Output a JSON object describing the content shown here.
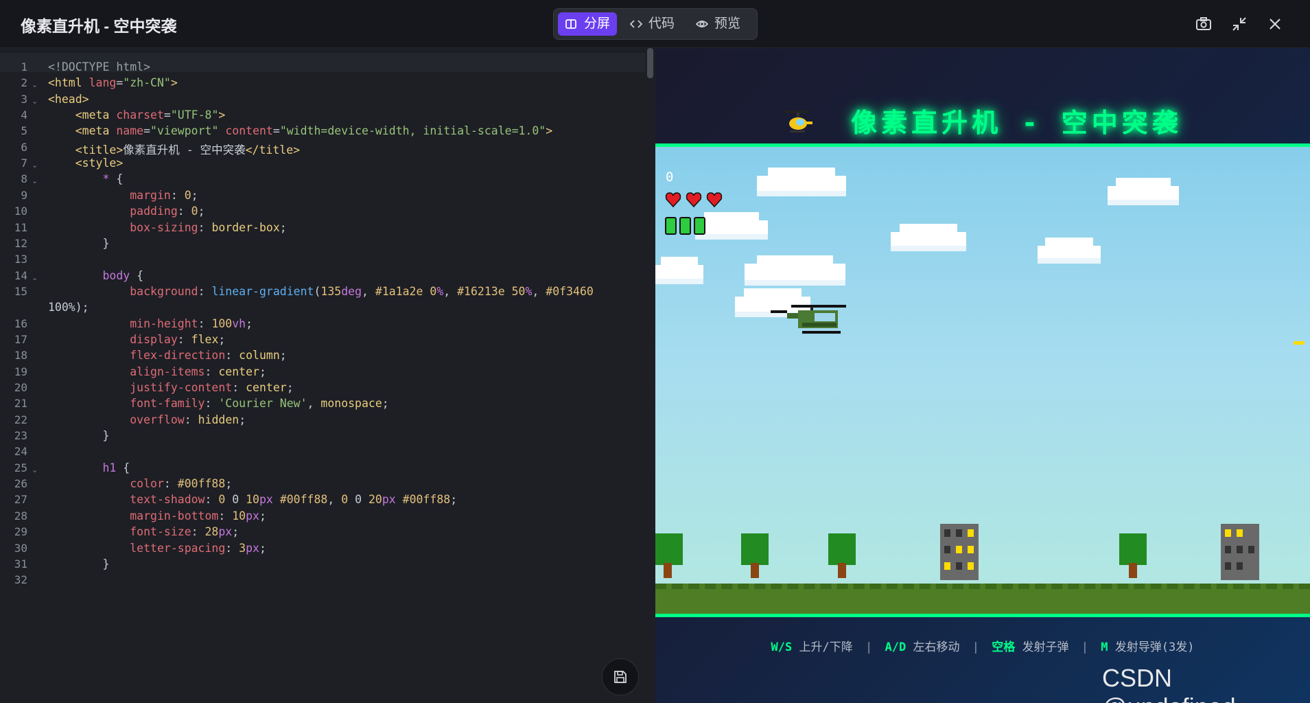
{
  "window": {
    "title": "像素直升机 - 空中突袭",
    "modes": [
      {
        "label": "分屏",
        "icon": "split-screen-icon",
        "active": true
      },
      {
        "label": "代码",
        "icon": "code-icon",
        "active": false
      },
      {
        "label": "预览",
        "icon": "eye-icon",
        "active": false
      }
    ],
    "actions": [
      "camera-icon",
      "minimize-icon",
      "close-icon"
    ],
    "accent": "#6b3ef0"
  },
  "editor": {
    "line_numbers": [
      "1",
      "2",
      "3",
      "4",
      "5",
      "6",
      "7",
      "8",
      "9",
      "10",
      "11",
      "12",
      "13",
      "14",
      "15",
      "",
      "16",
      "17",
      "18",
      "19",
      "20",
      "21",
      "22",
      "23",
      "24",
      "25",
      "26",
      "27",
      "28",
      "29",
      "30",
      "31",
      "32"
    ],
    "lines": [
      "<!DOCTYPE html>",
      "<html lang=\"zh-CN\">",
      "<head>",
      "    <meta charset=\"UTF-8\">",
      "    <meta name=\"viewport\" content=\"width=device-width, initial-scale=1.0\">",
      "    <title>像素直升机 - 空中突袭</title>",
      "    <style>",
      "        * {",
      "            margin: 0;",
      "            padding: 0;",
      "            box-sizing: border-box;",
      "        }",
      "",
      "        body {",
      "            background: linear-gradient(135deg, #1a1a2e 0%, #16213e 50%, #0f3460",
      "100%);",
      "            min-height: 100vh;",
      "            display: flex;",
      "            flex-direction: column;",
      "            align-items: center;",
      "            justify-content: center;",
      "            font-family: 'Courier New', monospace;",
      "            overflow: hidden;",
      "        }",
      "",
      "        h1 {",
      "            color: #00ff88;",
      "            text-shadow: 0 0 10px #00ff88, 0 0 20px #00ff88;",
      "            margin-bottom: 10px;",
      "            font-size: 28px;",
      "            letter-spacing: 3px;",
      "        }",
      ""
    ],
    "fold_lines": [
      2,
      3,
      7,
      8,
      14,
      25
    ],
    "save_icon": "save-icon"
  },
  "preview": {
    "heading": "像素直升机 - 空中突袭",
    "heading_icon": "helicopter-icon",
    "hud": {
      "score": "0",
      "lives": 3,
      "life_icon": "heart-icon",
      "missiles": 3,
      "missile_icon": "missile-battery-icon"
    },
    "controls": [
      {
        "key": "W/S",
        "desc": "上升/下降"
      },
      {
        "key": "A/D",
        "desc": "左右移动"
      },
      {
        "key": "空格",
        "desc": "发射子弹"
      },
      {
        "key": "M",
        "desc": "发射导弹(3发)"
      }
    ],
    "colors": {
      "title": "#00ff88",
      "sky": "#87ceeb",
      "grass": "#4e7d25"
    }
  },
  "watermark": "CSDN @undefined"
}
